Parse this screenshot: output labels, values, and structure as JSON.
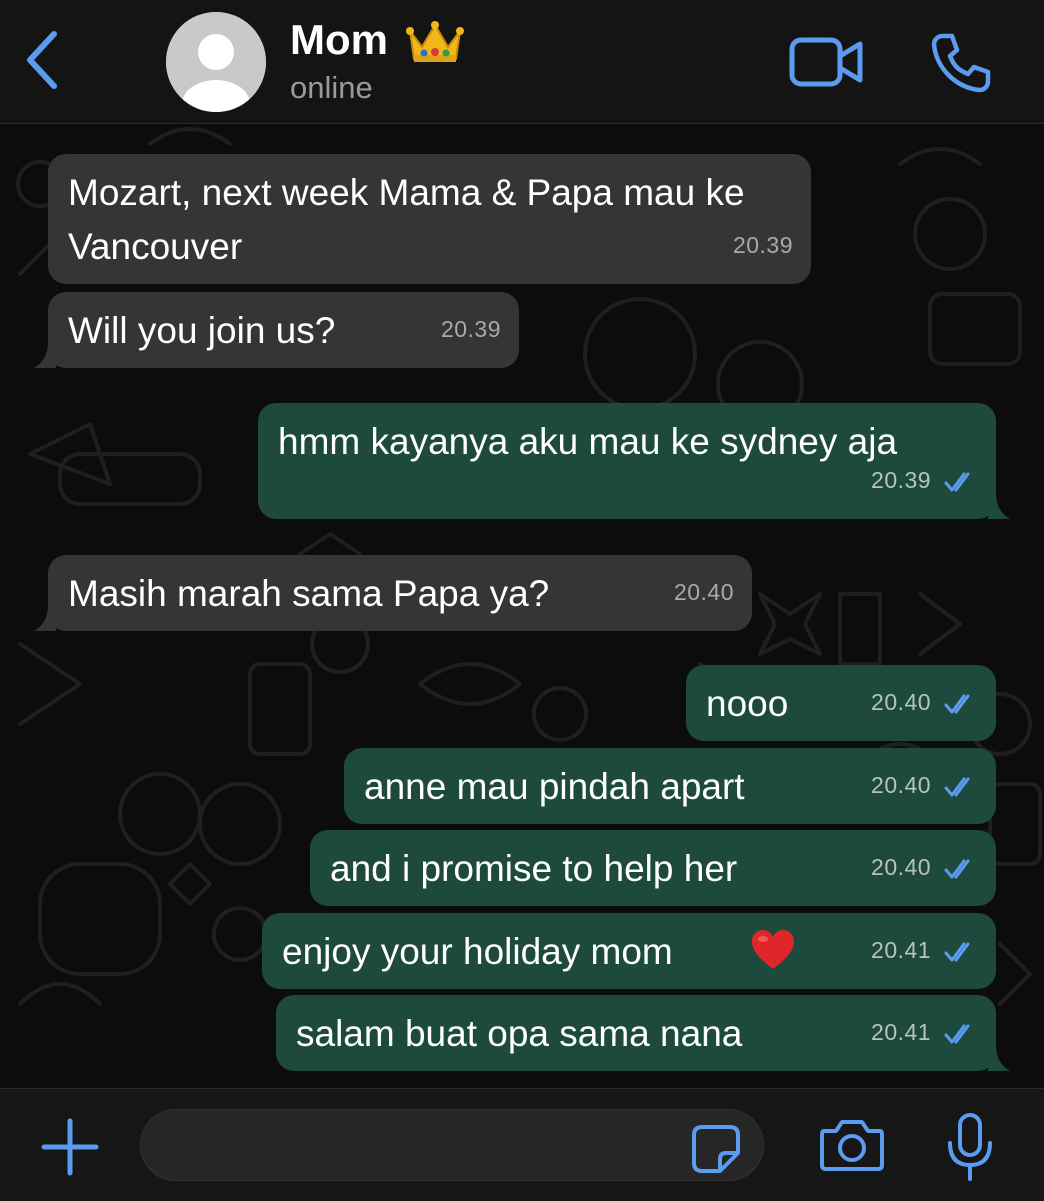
{
  "header": {
    "contact_name": "Mom",
    "status": "online",
    "back_icon": "chevron-left-icon",
    "video_icon": "video-camera-icon",
    "call_icon": "phone-icon",
    "accent_color": "#5b9bf0"
  },
  "messages": [
    {
      "direction": "in",
      "text": "Mozart, next week Mama & Papa mau ke Vancouver",
      "time": "20.39"
    },
    {
      "direction": "in",
      "text": "Will you join us?",
      "time": "20.39"
    },
    {
      "direction": "out",
      "text": "hmm kayanya aku mau ke sydney aja",
      "time": "20.39",
      "read": true
    },
    {
      "direction": "in",
      "text": "Masih marah sama Papa ya?",
      "time": "20.40"
    },
    {
      "direction": "out",
      "text": "nooo",
      "time": "20.40",
      "read": true
    },
    {
      "direction": "out",
      "text": "anne mau pindah apart",
      "time": "20.40",
      "read": true
    },
    {
      "direction": "out",
      "text": "and i promise to help her",
      "time": "20.40",
      "read": true
    },
    {
      "direction": "out",
      "text": "enjoy your holiday mom",
      "emoji": "heart-emoji",
      "time": "20.41",
      "read": true
    },
    {
      "direction": "out",
      "text": "salam buat opa sama nana",
      "time": "20.41",
      "read": true
    }
  ],
  "colors": {
    "incoming_bubble": "#353535",
    "outgoing_bubble": "#1d4a3d",
    "read_ticks": "#5b9bf0"
  },
  "input": {
    "value": "",
    "placeholder": ""
  }
}
